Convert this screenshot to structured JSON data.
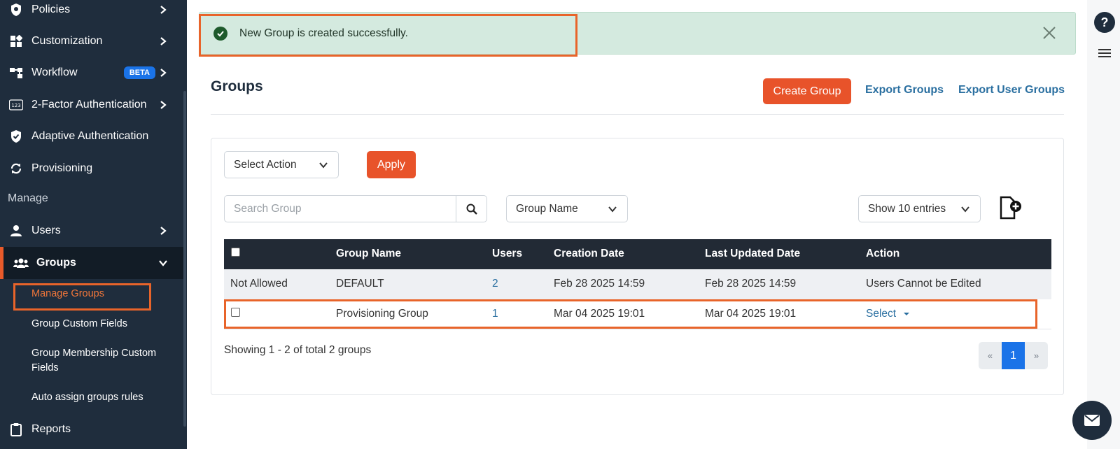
{
  "sidebar": {
    "items": [
      {
        "label": "Policies",
        "icon": "shield-search-icon"
      },
      {
        "label": "Customization",
        "icon": "widgets-icon"
      },
      {
        "label": "Workflow",
        "icon": "workflow-icon",
        "badge": "BETA"
      },
      {
        "label": "2-Factor Authentication",
        "icon": "numeric-123-icon"
      },
      {
        "label": "Adaptive Authentication",
        "icon": "shield-check-icon"
      },
      {
        "label": "Provisioning",
        "icon": "sync-icon"
      }
    ],
    "section_label": "Manage",
    "users_label": "Users",
    "groups_label": "Groups",
    "group_subitems": [
      "Manage Groups",
      "Group Custom Fields",
      "Group Membership Custom Fields",
      "Auto assign groups rules"
    ],
    "reports_label": "Reports"
  },
  "alert": {
    "message": "New Group is created successfully."
  },
  "header": {
    "title": "Groups",
    "create_label": "Create Group",
    "export_groups_label": "Export Groups",
    "export_user_groups_label": "Export User Groups"
  },
  "toolbar": {
    "select_action": "Select Action",
    "apply_label": "Apply",
    "search_placeholder": "Search Group",
    "filter_field": "Group Name",
    "entries": "Show 10 entries"
  },
  "table": {
    "columns": [
      "Group Name",
      "Users",
      "Creation Date",
      "Last Updated Date",
      "Action"
    ],
    "rows": [
      {
        "select": "Not Allowed",
        "group_name": "DEFAULT",
        "users": "2",
        "created": "Feb 28 2025 14:59",
        "updated": "Feb 28 2025 14:59",
        "action": "Users Cannot be Edited"
      },
      {
        "select": "",
        "group_name": "Provisioning Group",
        "users": "1",
        "created": "Mar 04 2025 19:01",
        "updated": "Mar 04 2025 19:01",
        "action": "Select"
      }
    ]
  },
  "footer": {
    "showing": "Showing 1 - 2 of total 2 groups",
    "pager": {
      "prev": "«",
      "current": "1",
      "next": "»"
    }
  },
  "rail": {
    "help": "?"
  },
  "colors": {
    "accent": "#e8532a",
    "sidebar": "#1f2d3d",
    "link": "#2a6fa0",
    "success_bg": "#d4eadf",
    "highlight": "#e8642a"
  }
}
